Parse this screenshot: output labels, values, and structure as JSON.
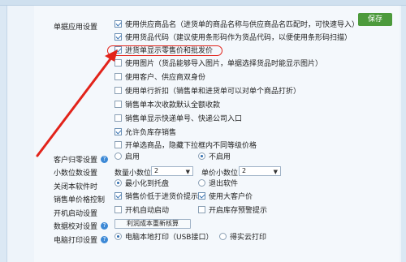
{
  "save_label": "保存",
  "section_title": "单据应用设置",
  "options": [
    {
      "label": "使用供应商品名（进货单的商品名称与供应商品名匹配时，可快速导入）",
      "checked": true
    },
    {
      "label": "使用货品代码（建议使用条形码作为货品代码，以便使用条形码扫描）",
      "checked": true
    },
    {
      "label": "进货单显示零售价和批发价",
      "checked": true
    },
    {
      "label": "使用图片（货品能够导入图片，单据选择货品时能显示图片）",
      "checked": false
    },
    {
      "label": "使用客户、供应商双身份",
      "checked": false
    },
    {
      "label": "使用单行折扣（销售单和进货单可以对单个商品打折）",
      "checked": false
    },
    {
      "label": "销售单本次收款默认全额收款",
      "checked": false
    },
    {
      "label": "销售单显示快递单号、快递公司入口",
      "checked": false
    },
    {
      "label": "允许负库存销售",
      "checked": true
    },
    {
      "label": "开单选商品，隐藏下拉框内不同等级价格",
      "checked": false
    }
  ],
  "customer_zero": {
    "label": "客户归零设置",
    "opt1": "启用",
    "opt2": "不启用",
    "selected": "不启用"
  },
  "decimal": {
    "label": "小数位数设置",
    "qty_label": "数量小数位",
    "qty_value": "2",
    "price_label": "单价小数位",
    "price_value": "2"
  },
  "close_software": {
    "label": "关闭本软件时",
    "opt1": "最小化到托盘",
    "opt2": "退出软件",
    "selected": "最小化到托盘"
  },
  "price_control": {
    "label": "销售单价格控制",
    "opt1": "销售价低于进货价提示",
    "opt2": "使用大客户价",
    "checked1": true,
    "checked2": true
  },
  "startup": {
    "label": "开机启动设置",
    "opt1": "开机自动启动",
    "opt2": "开启库存预警提示",
    "checked1": false,
    "checked2": false
  },
  "data_check": {
    "label": "数据校对设置",
    "button": "利润成本重新核算"
  },
  "print": {
    "label": "电脑打印设置",
    "opt1": "电脑本地打印（USB接口）",
    "opt2": "得实云打印",
    "selected": "电脑本地打印（USB接口）"
  },
  "colors": {
    "accent": "#2f6db0",
    "save": "#4c9a3c",
    "highlight": "#e2231a"
  }
}
